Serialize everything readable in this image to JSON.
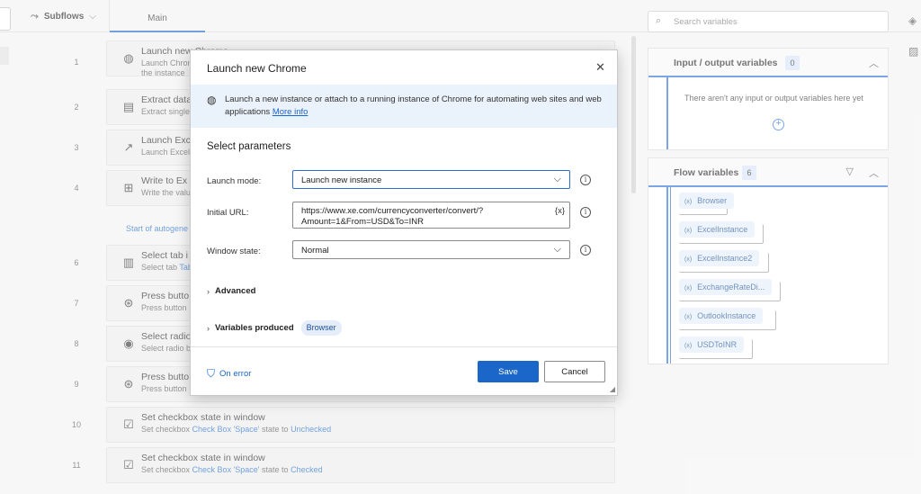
{
  "topbar": {
    "subflows_label": "Subflows",
    "main_tab": "Main"
  },
  "actions": [
    {
      "num": "1",
      "title": "Launch new Chrome",
      "sub": "Launch Chrome",
      "sub2": "the instance",
      "icon": "globe-icon"
    },
    {
      "num": "2",
      "title": "Extract data",
      "sub": "Extract single",
      "icon": "extract-icon"
    },
    {
      "num": "3",
      "title": "Launch Excel",
      "sub": "Launch Excel",
      "icon": "arrow-launch-icon"
    },
    {
      "num": "4",
      "title": "Write to Ex",
      "sub": "Write the valu",
      "icon": "excel-icon"
    },
    {
      "num": "6",
      "title": "Select tab i",
      "sub": "Select tab",
      "sub_link": "Tab",
      "icon": "tab-icon"
    },
    {
      "num": "7",
      "title": "Press butto",
      "sub": "Press button",
      "icon": "press-button-icon"
    },
    {
      "num": "8",
      "title": "Select radio",
      "sub": "Select radio b",
      "icon": "radio-icon"
    },
    {
      "num": "9",
      "title": "Press butto",
      "sub": "Press button",
      "icon": "press-button-icon"
    },
    {
      "num": "10",
      "title": "Set checkbox state in window",
      "sub_pre": "Set checkbox",
      "sub_link1": "Check Box 'Space'",
      "sub_mid": "state to",
      "sub_link2": "Unchecked",
      "icon": "checkbox-icon"
    },
    {
      "num": "11",
      "title": "Set checkbox state in window",
      "sub_pre": "Set checkbox",
      "sub_link1": "Check Box 'Space'",
      "sub_mid": "state to",
      "sub_link2": "Checked",
      "icon": "checkbox-icon"
    }
  ],
  "autogen_label": "Start of autogene",
  "right_panel": {
    "search_placeholder": "Search variables",
    "io_title": "Input / output variables",
    "io_count": "0",
    "io_empty": "There aren't any input or output variables here yet",
    "flow_title": "Flow variables",
    "flow_count": "6",
    "flow_vars": [
      "Browser",
      "ExcelInstance",
      "ExcelInstance2",
      "ExchangeRateDi...",
      "OutlookInstance",
      "USDToINR"
    ]
  },
  "dialog": {
    "title": "Launch new Chrome",
    "description": "Launch a new instance or attach to a running instance of Chrome for automating web sites and web applications",
    "more_info": "More info",
    "section_title": "Select parameters",
    "launch_mode_label": "Launch mode:",
    "launch_mode_value": "Launch new instance",
    "initial_url_label": "Initial URL:",
    "initial_url_value": "https://www.xe.com/currencyconverter/convert/?Amount=1&From=USD&To=INR",
    "variable_button": "{x}",
    "window_state_label": "Window state:",
    "window_state_value": "Normal",
    "advanced_label": "Advanced",
    "variables_produced_label": "Variables produced",
    "variables_produced_chip": "Browser",
    "on_error_label": "On error",
    "save_label": "Save",
    "cancel_label": "Cancel"
  }
}
